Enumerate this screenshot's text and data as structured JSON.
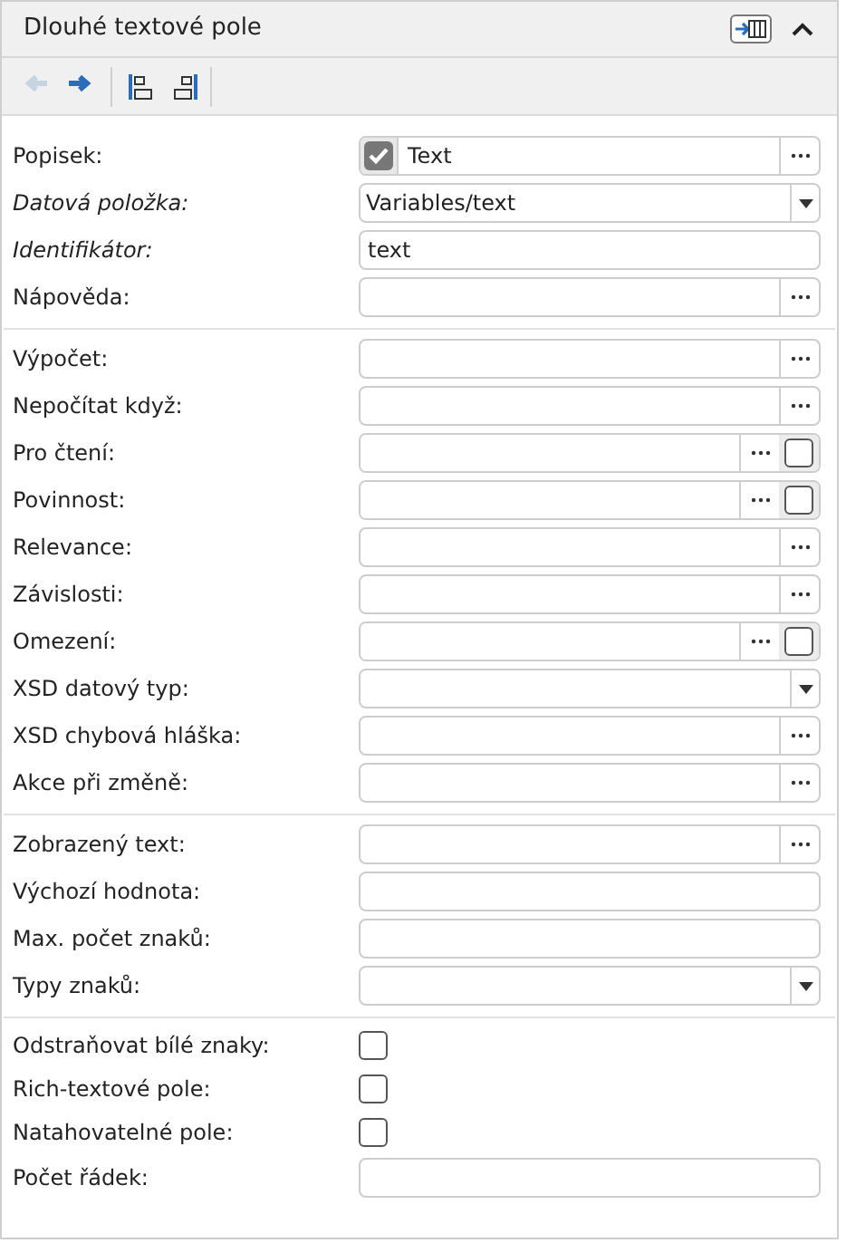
{
  "panel": {
    "title": "Dlouhé textové pole",
    "expanded": true
  },
  "toolbar": [
    {
      "kind": "back",
      "disabled": true
    },
    {
      "kind": "forward",
      "disabled": false
    },
    {
      "kind": "align_left",
      "disabled": false
    },
    {
      "kind": "align_right",
      "disabled": false
    }
  ],
  "sections": [
    {
      "rows": [
        {
          "label": "Popisek:",
          "italic": false,
          "kind": "check_text",
          "checked": true,
          "value": "Text"
        },
        {
          "label": "Datová položka:",
          "italic": true,
          "kind": "select",
          "value": "Variables/text"
        },
        {
          "label": "Identifikátor:",
          "italic": true,
          "kind": "text",
          "value": "text"
        },
        {
          "label": "Nápověda:",
          "italic": false,
          "kind": "ellipsis"
        }
      ]
    },
    {
      "rows": [
        {
          "label": "Výpočet:",
          "italic": false,
          "kind": "ellipsis"
        },
        {
          "label": "Nepočítat když:",
          "italic": false,
          "kind": "ellipsis"
        },
        {
          "label": "Pro čtení:",
          "italic": false,
          "kind": "ellipsis_check",
          "checked": false
        },
        {
          "label": "Povinnost:",
          "italic": false,
          "kind": "ellipsis_check",
          "checked": false
        },
        {
          "label": "Relevance:",
          "italic": false,
          "kind": "ellipsis"
        },
        {
          "label": "Závislosti:",
          "italic": false,
          "kind": "ellipsis"
        },
        {
          "label": "Omezení:",
          "italic": false,
          "kind": "ellipsis_check",
          "checked": false
        },
        {
          "label": "XSD datový typ:",
          "italic": false,
          "kind": "select"
        },
        {
          "label": "XSD chybová hláška:",
          "italic": false,
          "kind": "ellipsis"
        },
        {
          "label": "Akce při změně:",
          "italic": false,
          "kind": "ellipsis"
        }
      ]
    },
    {
      "rows": [
        {
          "label": "Zobrazený text:",
          "italic": false,
          "kind": "ellipsis"
        },
        {
          "label": "Výchozí hodnota:",
          "italic": false,
          "kind": "text"
        },
        {
          "label": "Max. počet znaků:",
          "italic": false,
          "kind": "text"
        },
        {
          "label": "Typy znaků:",
          "italic": false,
          "kind": "select"
        }
      ]
    },
    {
      "rows": [
        {
          "label": "Odstraňovat bílé znaky:",
          "italic": false,
          "kind": "checkbox",
          "checked": false
        },
        {
          "label": "Rich-textové pole:",
          "italic": false,
          "kind": "checkbox",
          "checked": false
        },
        {
          "label": "Natahovatelné pole:",
          "italic": false,
          "kind": "checkbox",
          "checked": false
        },
        {
          "label": "Počet řádek:",
          "italic": false,
          "kind": "text"
        }
      ]
    }
  ]
}
